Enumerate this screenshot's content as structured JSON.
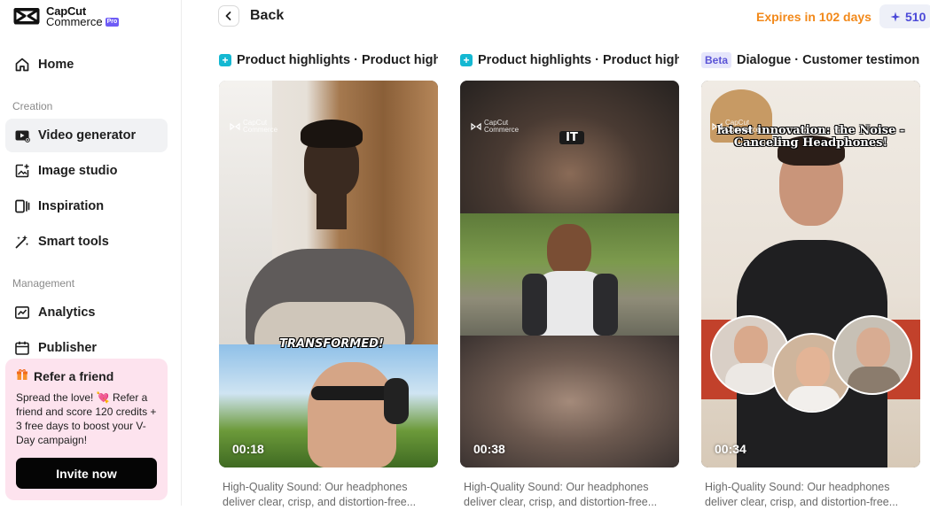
{
  "brand": {
    "line1": "CapCut",
    "line2": "Commerce",
    "badge": "Pro"
  },
  "nav": {
    "home": "Home",
    "creation_label": "Creation",
    "video_generator": "Video generator",
    "image_studio": "Image studio",
    "inspiration": "Inspiration",
    "smart_tools": "Smart tools",
    "management_label": "Management",
    "analytics": "Analytics",
    "publisher": "Publisher"
  },
  "refer": {
    "title": "Refer a friend",
    "desc": "Spread the love! 💘 Refer a friend and score 120 credits + 3 free days to boost your V-Day campaign!",
    "button": "Invite now"
  },
  "topbar": {
    "back": "Back",
    "expires": "Expires in 102 days",
    "credits": "510"
  },
  "cards": [
    {
      "title": "Product highlights · Product highl...",
      "duration": "00:18",
      "caption": "TRANSFORMED!",
      "desc": "High-Quality Sound: Our headphones deliver clear, crisp, and distortion-free..."
    },
    {
      "title": "Product highlights · Product highl...",
      "duration": "00:38",
      "caption": "IT",
      "desc": "High-Quality Sound: Our headphones deliver clear, crisp, and distortion-free..."
    },
    {
      "badge": "Beta",
      "title": "Dialogue · Customer testimonial",
      "duration": "00:34",
      "caption": "latest innovation: the Noise -Canceling Headphones!",
      "desc": "High-Quality Sound: Our headphones deliver clear, crisp, and distortion-free..."
    }
  ],
  "colors": {
    "accent": "#4b49d8",
    "expires": "#f2891a",
    "refer_bg": "#fde3ee",
    "plus": "#14b8d2"
  }
}
